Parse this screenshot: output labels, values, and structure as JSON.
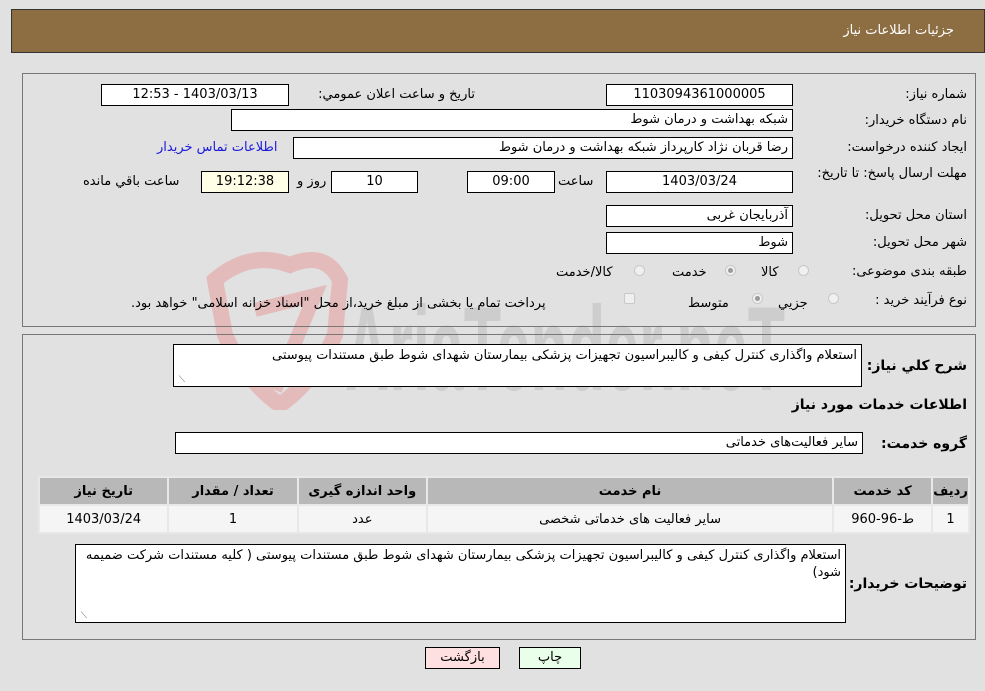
{
  "header": {
    "title": "جزئیات اطلاعات نیاز"
  },
  "form": {
    "need_number": {
      "label": "شماره نیاز:",
      "value": "1103094361000005"
    },
    "announce_datetime": {
      "label": "تاریخ و ساعت اعلان عمومي:",
      "value": "1403/03/13 - 12:53"
    },
    "buyer_org": {
      "label": "نام دستگاه خریدار:",
      "value": "شبکه بهداشت و درمان شوط"
    },
    "requester": {
      "label": "ایجاد کننده درخواست:",
      "value": "رضا قربان نژاد کارپرداز شبکه بهداشت و درمان شوط"
    },
    "buyer_contact_link": "اطلاعات تماس خریدار",
    "deadline": {
      "label": "مهلت ارسال پاسخ: تا تاریخ:",
      "date": "1403/03/24",
      "time_label": "ساعت",
      "time": "09:00",
      "days": "10",
      "days_label": "روز و",
      "remaining": "19:12:38",
      "remaining_label": "ساعت باقي مانده"
    },
    "province": {
      "label": "استان محل تحویل:",
      "value": "آذربایجان غربی"
    },
    "city": {
      "label": "شهر محل تحویل:",
      "value": "شوط"
    },
    "category": {
      "label": "طبقه بندی موضوعی:",
      "options": [
        "کالا",
        "خدمت",
        "کالا/خدمت"
      ],
      "selected": "خدمت"
    },
    "purchase_type": {
      "label": "نوع فرآیند خرید :",
      "options": [
        "جزيي",
        "متوسط"
      ],
      "selected": "متوسط",
      "treasury_checkbox_label": "پرداخت تمام یا بخشی از مبلغ خرید،از محل \"اسناد خزانه اسلامی\" خواهد بود.",
      "treasury_checked": false
    }
  },
  "description": {
    "label": "شرح كلي نياز:",
    "value": "استعلام واگذاری کنترل کیفی و کالیبراسیون تجهیزات پزشکی بیمارستان شهدای شوط طبق مستندات پیوستی"
  },
  "services_section": {
    "title": "اطلاعات خدمات مورد نیاز",
    "group_label": "گروه خدمت:",
    "group_value": "سایر فعالیت‌های خدماتی"
  },
  "table": {
    "headers": [
      "ردیف",
      "کد خدمت",
      "نام خدمت",
      "واحد اندازه گیری",
      "تعداد / مقدار",
      "تاریخ نیاز"
    ],
    "rows": [
      [
        "1",
        "ط-96-960",
        "سایر فعالیت های خدماتی شخصی",
        "عدد",
        "1",
        "1403/03/24"
      ]
    ]
  },
  "buyer_notes": {
    "label": "توضیحات خریدار:",
    "value": "استعلام واگذاری کنترل کیفی و کالیبراسیون تجهیزات پزشکی بیمارستان شهدای شوط طبق مستندات پیوستی ( کلیه مستندات شرکت ضمیمه شود)"
  },
  "buttons": {
    "print": "چاپ",
    "back": "بازگشت"
  },
  "watermark": {
    "text": "AriaTender.neT"
  },
  "colors": {
    "header_bg": "#8d6d42",
    "link": "#1a1adb",
    "back_btn": "#ffe0e0",
    "print_btn": "#eaffea"
  }
}
